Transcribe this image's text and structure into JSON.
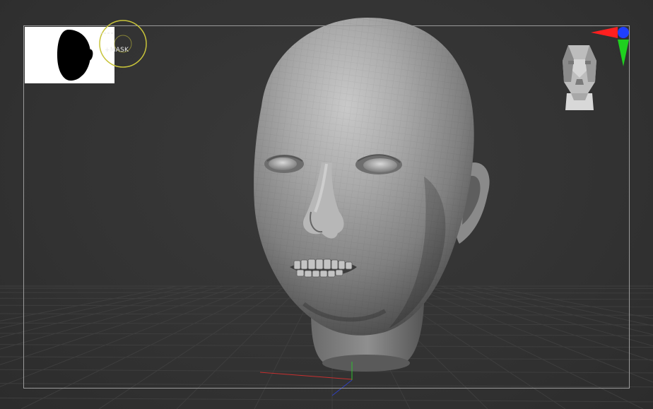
{
  "viewport": {
    "background_color": "#333333",
    "frame_color": "#9a9a9a",
    "grid_color": "#3e3e3e"
  },
  "thumbnail": {
    "background_color": "#ffffff",
    "silhouette_color": "#000000",
    "icon": "head-silhouette-icon"
  },
  "brush_cursor": {
    "label": "MASK",
    "label_prefix": "+",
    "ring_color": "#c8c43a",
    "icon": "brush-ring-icon"
  },
  "nav_cube": {
    "icon": "head-navigation-icon"
  },
  "axis_gizmo": {
    "x_color": "#ff1f1f",
    "y_color": "#1fd01f",
    "z_color": "#1f3fff"
  },
  "floor_axes": {
    "x_color": "#c83030",
    "y_color": "#30c030",
    "z_color": "#3040c0"
  },
  "model": {
    "icon": "sculpted-head-model",
    "surface_color": "#9a9a9a"
  }
}
